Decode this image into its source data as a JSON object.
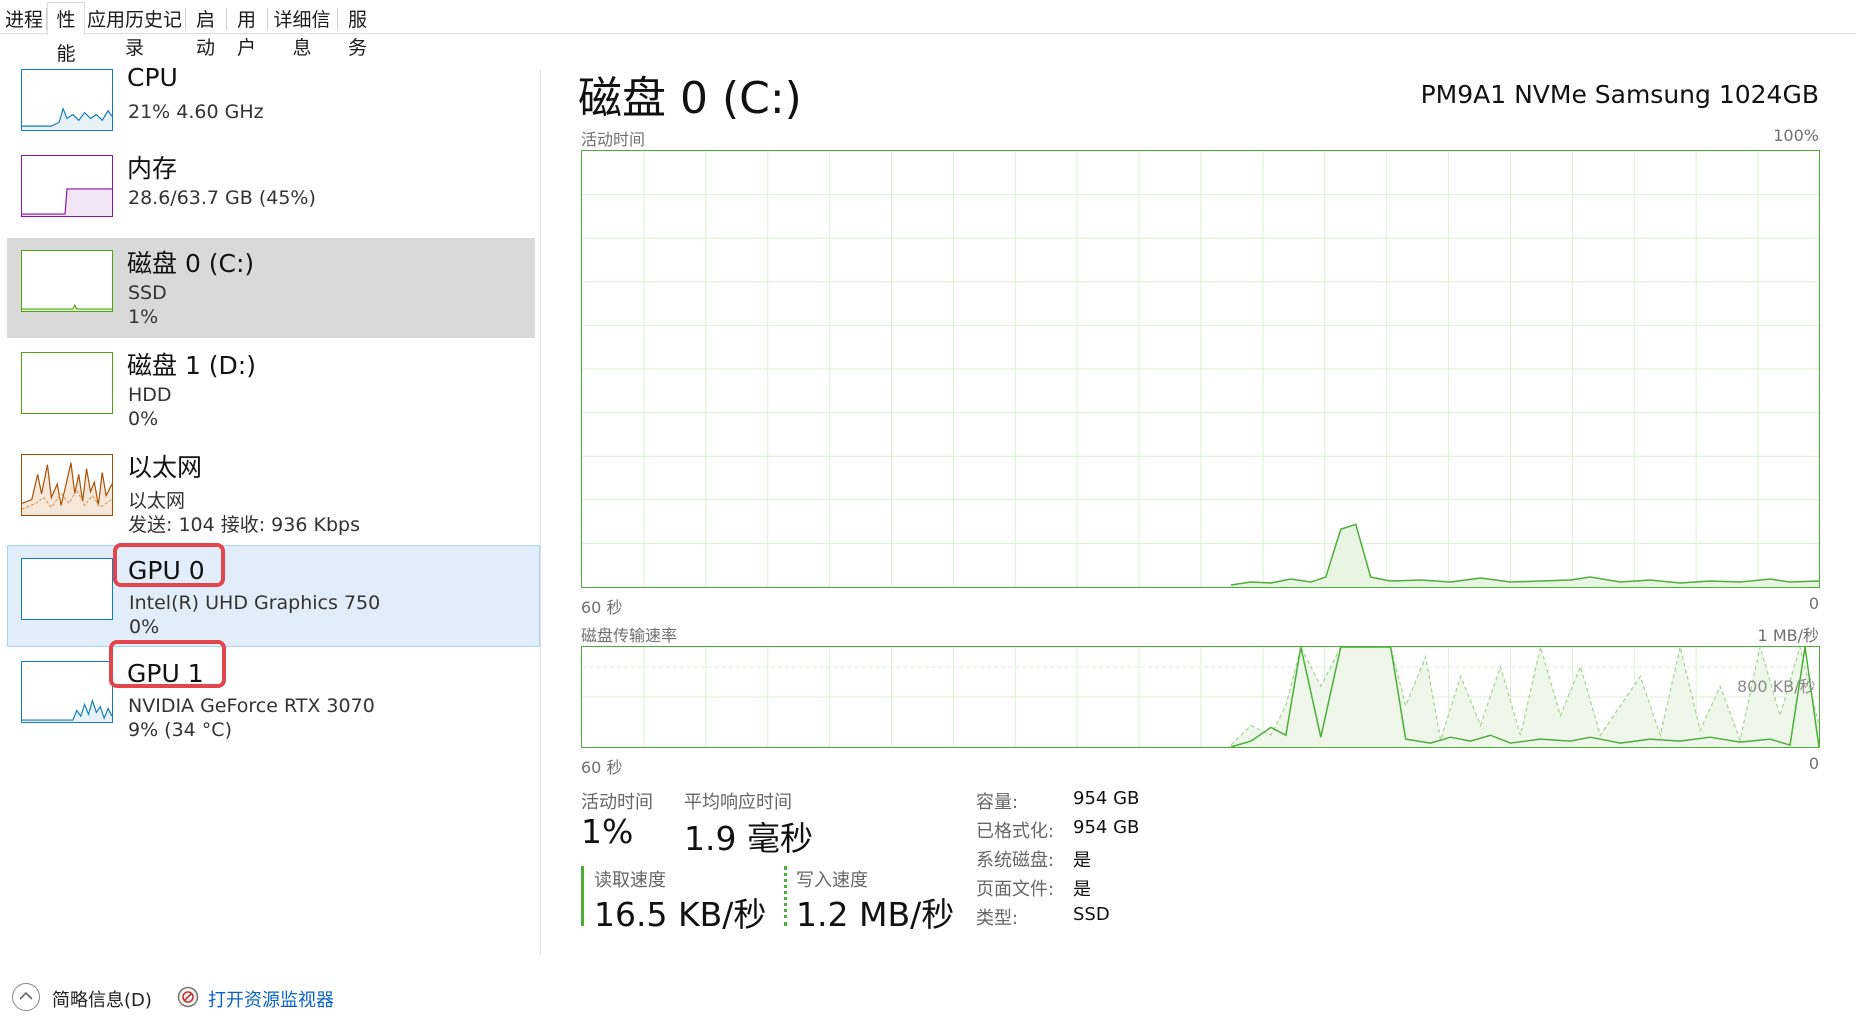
{
  "tabs": [
    {
      "label": "进程"
    },
    {
      "label": "性能"
    },
    {
      "label": "应用历史记录"
    },
    {
      "label": "启动"
    },
    {
      "label": "用户"
    },
    {
      "label": "详细信息"
    },
    {
      "label": "服务"
    }
  ],
  "active_tab": "性能",
  "sidebar": {
    "items": [
      {
        "title": "CPU",
        "line1": "21%  4.60 GHz",
        "line2": "",
        "color": "#117dbb",
        "state": "normal"
      },
      {
        "title": "内存",
        "line1": "28.6/63.7 GB (45%)",
        "line2": "",
        "color": "#8b12ae",
        "state": "normal"
      },
      {
        "title": "磁盘 0 (C:)",
        "line1": "SSD",
        "line2": "1%",
        "color": "#4da60c",
        "state": "selected"
      },
      {
        "title": "磁盘 1 (D:)",
        "line1": "HDD",
        "line2": "0%",
        "color": "#4da60c",
        "state": "normal"
      },
      {
        "title": "以太网",
        "line1": "以太网",
        "line2": "发送: 104 接收: 936 Kbps",
        "color": "#a74f01",
        "state": "normal"
      },
      {
        "title": "GPU 0",
        "line1": "Intel(R) UHD Graphics 750",
        "line2": "0%",
        "color": "#117dbb",
        "state": "hover"
      },
      {
        "title": "GPU 1",
        "line1": "NVIDIA GeForce RTX 3070",
        "line2": "9% (34 °C)",
        "color": "#117dbb",
        "state": "normal"
      }
    ]
  },
  "main": {
    "title": "磁盘 0 (C:)",
    "model": "PM9A1 NVMe Samsung 1024GB",
    "graph1": {
      "label": "活动时间",
      "max": "100%",
      "x_left": "60 秒",
      "x_right": "0"
    },
    "graph2": {
      "label": "磁盘传输速率",
      "max": "1 MB/秒",
      "mid": "800 KB/秒",
      "x_left": "60 秒",
      "x_right": "0"
    },
    "stats": {
      "active_time_label": "活动时间",
      "active_time_value": "1%",
      "avg_response_label": "平均响应时间",
      "avg_response_value": "1.9 毫秒",
      "read_label": "读取速度",
      "read_value": "16.5 KB/秒",
      "write_label": "写入速度",
      "write_value": "1.2 MB/秒"
    },
    "properties": [
      {
        "key": "容量:",
        "value": "954 GB"
      },
      {
        "key": "已格式化:",
        "value": "954 GB"
      },
      {
        "key": "系统磁盘:",
        "value": "是"
      },
      {
        "key": "页面文件:",
        "value": "是"
      },
      {
        "key": "类型:",
        "value": "SSD"
      }
    ]
  },
  "footer": {
    "summary_label": "简略信息(D)",
    "monitor_link": "打开资源监视器"
  },
  "colors": {
    "disk_green": "#4caf38",
    "highlight_red": "#e2454b",
    "link_blue": "#0a64c8"
  }
}
